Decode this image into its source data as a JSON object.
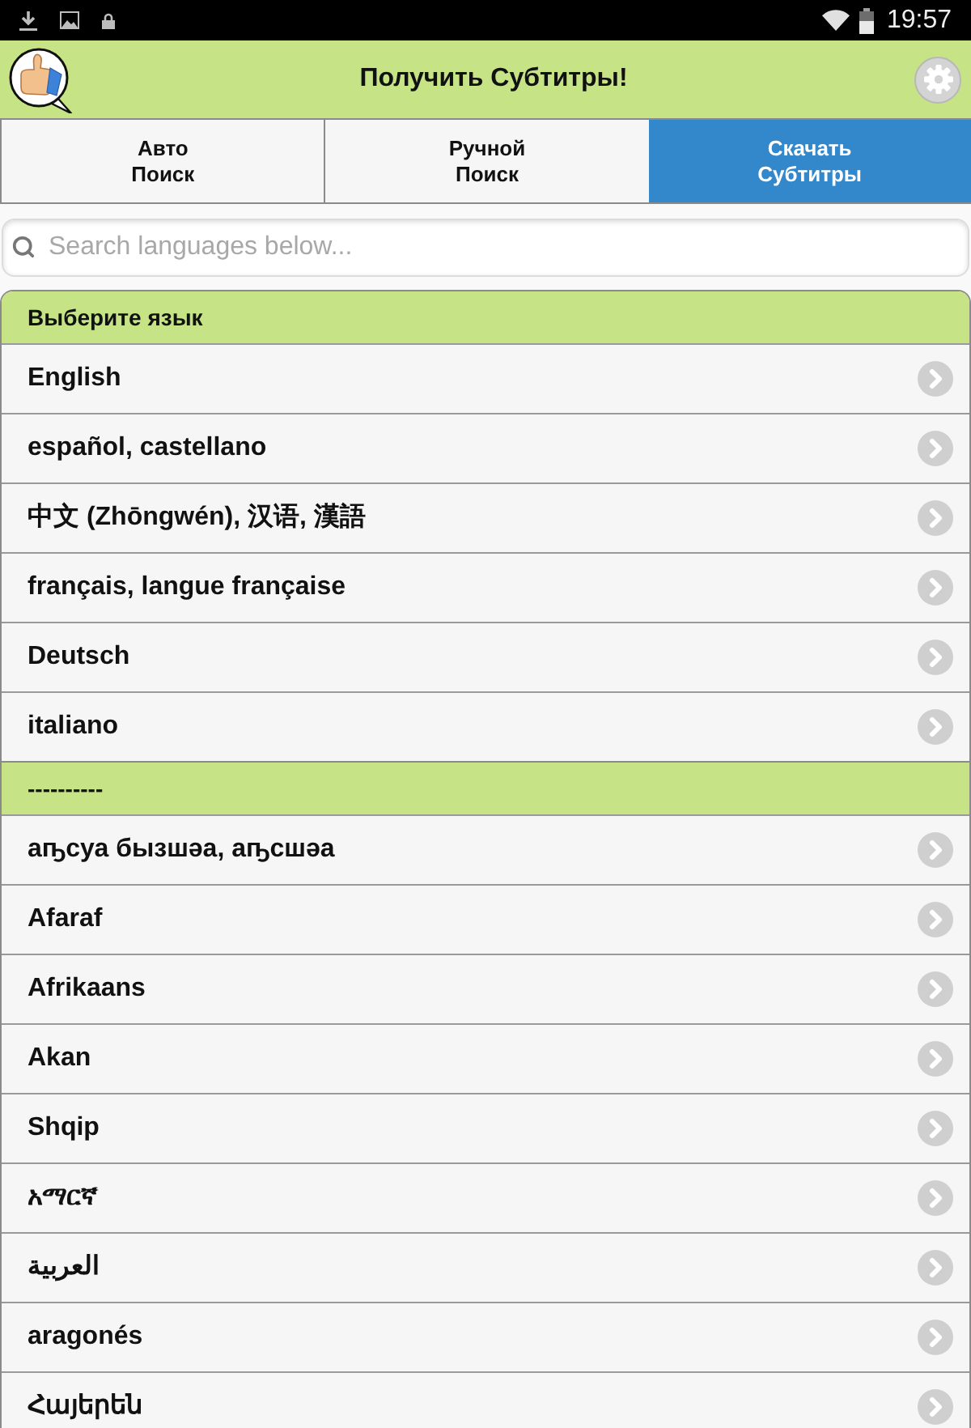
{
  "status_bar": {
    "time": "19:57"
  },
  "header": {
    "title": "Получить Субтитры!"
  },
  "tabs": [
    {
      "label": "Авто\nПоиск",
      "selected": false
    },
    {
      "label": "Ручной\nПоиск",
      "selected": false
    },
    {
      "label": "Скачать\nСубтитры",
      "selected": true
    }
  ],
  "search": {
    "placeholder": "Search languages below..."
  },
  "language_list": [
    {
      "kind": "header",
      "label": "Выберите язык"
    },
    {
      "kind": "language",
      "label": "English"
    },
    {
      "kind": "language",
      "label": "español, castellano"
    },
    {
      "kind": "language",
      "label": "中文 (Zhōngwén), 汉语, 漢語"
    },
    {
      "kind": "language",
      "label": "français, langue française"
    },
    {
      "kind": "language",
      "label": "Deutsch"
    },
    {
      "kind": "language",
      "label": "italiano"
    },
    {
      "kind": "divider",
      "label": "----------"
    },
    {
      "kind": "language",
      "label": "аҧсуа бызшәа, аҧсшәа"
    },
    {
      "kind": "language",
      "label": "Afaraf"
    },
    {
      "kind": "language",
      "label": "Afrikaans"
    },
    {
      "kind": "language",
      "label": "Akan"
    },
    {
      "kind": "language",
      "label": "Shqip"
    },
    {
      "kind": "language",
      "label": "አማርኛ"
    },
    {
      "kind": "language",
      "label": "العربية"
    },
    {
      "kind": "language",
      "label": "aragonés"
    },
    {
      "kind": "language",
      "label": "Հայերեն"
    }
  ]
}
